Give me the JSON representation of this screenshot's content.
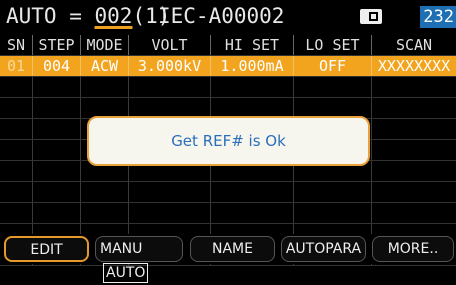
{
  "header": {
    "auto_prefix": "AUTO = ",
    "auto_number": "002",
    "auto_suffix": "(1)",
    "iec": "IEC-A00002",
    "badge": "232"
  },
  "table": {
    "columns": [
      "SN",
      "STEP",
      "MODE",
      "VOLT",
      "HI SET",
      "LO SET",
      "SCAN"
    ],
    "rows": [
      {
        "sn": "01",
        "step": "004",
        "mode": "ACW",
        "volt": "3.000kV",
        "hi": "1.000mA",
        "lo": "OFF",
        "scan": "XXXXXXXX"
      }
    ]
  },
  "popup": {
    "message": "Get REF# is Ok"
  },
  "footer": {
    "edit": "EDIT",
    "manu": "MANU",
    "auto": "AUTO",
    "name": "NAME",
    "autopara": "AUTOPARA",
    "more": "MORE.."
  },
  "colors": {
    "selected_row": "#f3a41f",
    "badge": "#1f6fb5",
    "popup_text": "#2b6fb8",
    "accent": "#e49a2a"
  }
}
